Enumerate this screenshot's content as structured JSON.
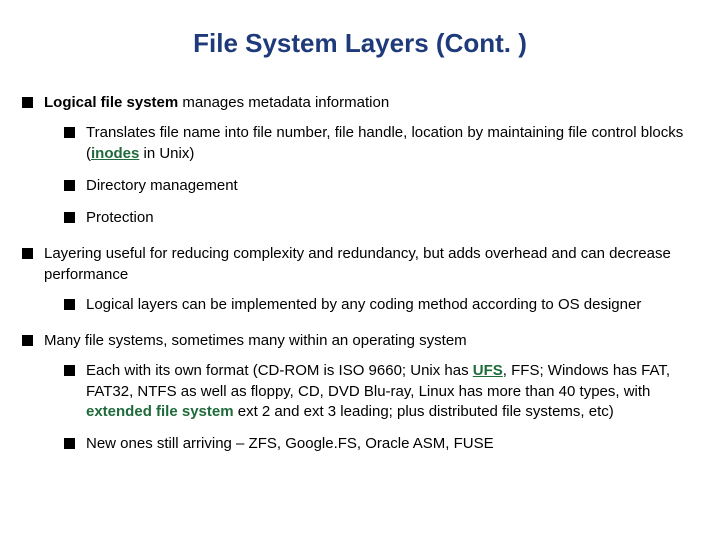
{
  "title": "File System Layers (Cont. )",
  "b1": {
    "strong": "Logical file system",
    "rest": " manages metadata information",
    "s1a": "Translates file name into file number, file handle, location by maintaining file control blocks (",
    "s1link": "inodes",
    "s1b": " in Unix)",
    "s2": "Directory management",
    "s3": "Protection"
  },
  "b2": {
    "text": "Layering useful for reducing complexity and redundancy, but adds overhead and can decrease performance",
    "s1": "Logical layers can be implemented by any coding method according to OS designer"
  },
  "b3": {
    "text": "Many file systems, sometimes many within an operating system",
    "s1a": "Each with its own format (CD-ROM is ISO 9660; Unix has ",
    "s1ufs": "UFS",
    "s1b": ", FFS; Windows has FAT, FAT32, NTFS as well as floppy, CD, DVD Blu-ray, Linux has more than 40 types, with ",
    "s1ext": "extended file system",
    "s1c": " ext 2 and ext 3 leading; plus distributed file systems, etc)",
    "s2": "New ones still arriving – ZFS, Google.FS, Oracle ASM, FUSE"
  }
}
